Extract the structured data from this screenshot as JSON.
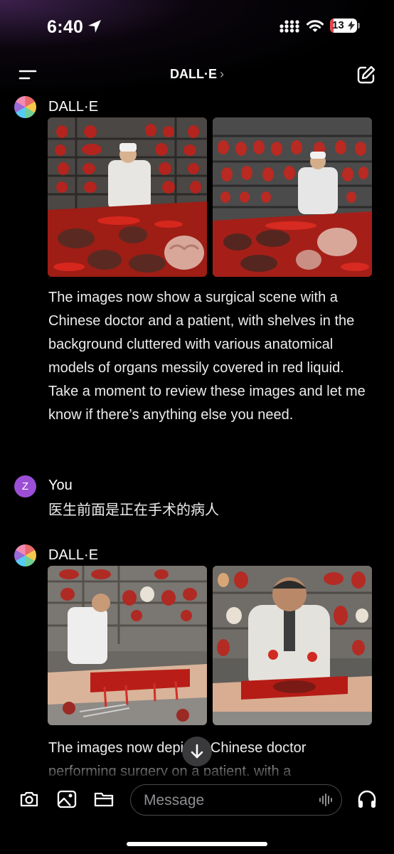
{
  "status_bar": {
    "time": "6:40",
    "battery": "13",
    "battery_level": 0.13,
    "icons": [
      "location-arrow-icon",
      "cellular-signal-icon",
      "wifi-icon",
      "battery-charging-icon"
    ]
  },
  "header": {
    "title": "DALL·E",
    "chevron": "›",
    "icons": [
      "menu-icon",
      "new-chat-icon"
    ]
  },
  "messages": [
    {
      "sender": "DALL·E",
      "avatar": "dalle-avatar",
      "text": "The images now show a surgical scene with a Chinese doctor and a patient, with shelves in the background cluttered with various anatomical models of organs messily covered in red liquid. Take a moment to review these images and let me know if there’s anything else you need."
    },
    {
      "sender": "You",
      "avatar_initial": "Z",
      "text": "医生前面是正在手术的病人"
    },
    {
      "sender": "DALL·E",
      "avatar": "dalle-avatar",
      "text": "The images now depict a Chinese doctor performing surgery on a patient, with a"
    }
  ],
  "input_bar": {
    "placeholder": "Message",
    "icons": [
      "camera-icon",
      "photo-library-icon",
      "folder-icon",
      "voice-waveform-icon",
      "headphones-icon"
    ]
  },
  "colors": {
    "background": "#000000",
    "text": "#ececec",
    "battery_low": "#e5484d",
    "user_avatar": "#9b4fd6"
  }
}
